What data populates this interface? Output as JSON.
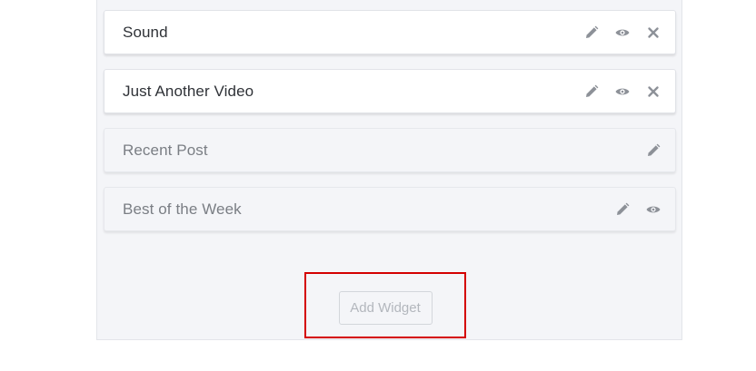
{
  "widgets": [
    {
      "title": "Sound",
      "state": "active",
      "actions": [
        "pencil-icon",
        "eye-icon",
        "close-icon"
      ]
    },
    {
      "title": "Just Another Video",
      "state": "active",
      "actions": [
        "pencil-icon",
        "eye-icon",
        "close-icon"
      ]
    },
    {
      "title": "Recent Post",
      "state": "inactive",
      "actions": [
        "pencil-icon"
      ]
    },
    {
      "title": "Best of the Week",
      "state": "inactive",
      "actions": [
        "pencil-icon",
        "eye-icon"
      ]
    }
  ],
  "add_widget": {
    "label": "Add Widget"
  },
  "colors": {
    "icon": "#8d9198",
    "highlight_border": "#d40000",
    "panel_bg": "#f4f5f8"
  }
}
